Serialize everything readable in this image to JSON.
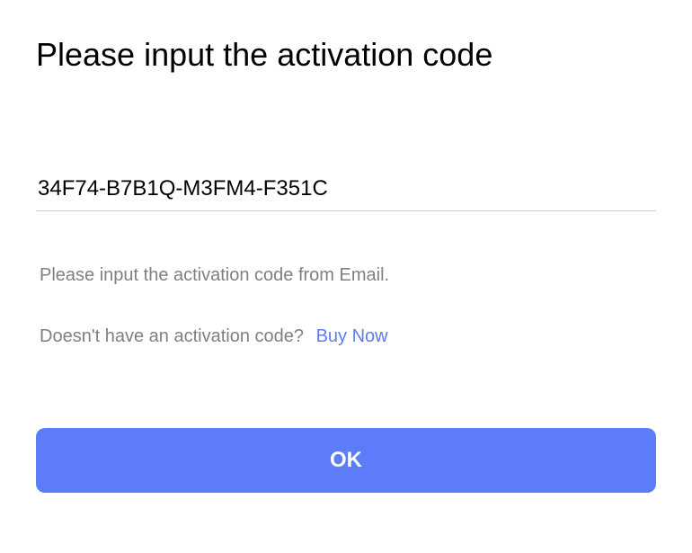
{
  "title": "Please input the activation code",
  "input": {
    "value": "34F74-B7B1Q-M3FM4-F351C",
    "placeholder": ""
  },
  "helper_text": "Please input the activation code from Email.",
  "buy_prompt": "Doesn't have an activation code?",
  "buy_link_label": "Buy Now",
  "ok_button_label": "OK"
}
